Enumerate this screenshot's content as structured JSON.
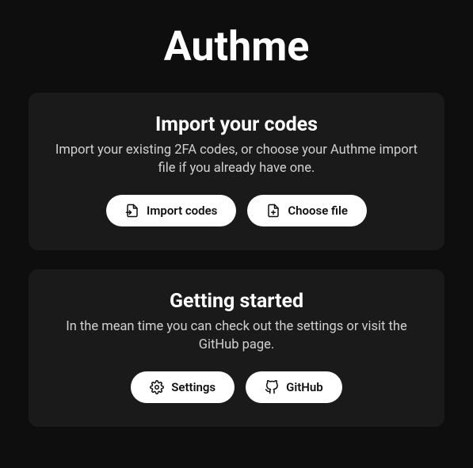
{
  "app": {
    "title": "Authme"
  },
  "cards": {
    "import": {
      "title": "Import your codes",
      "description": "Import your existing 2FA codes, or choose your Authme import file if you already have one.",
      "buttons": {
        "import_codes": "Import codes",
        "choose_file": "Choose file"
      }
    },
    "getting_started": {
      "title": "Getting started",
      "description": "In the mean time you can check out the settings or visit the GitHub page.",
      "buttons": {
        "settings": "Settings",
        "github": "GitHub"
      }
    }
  }
}
